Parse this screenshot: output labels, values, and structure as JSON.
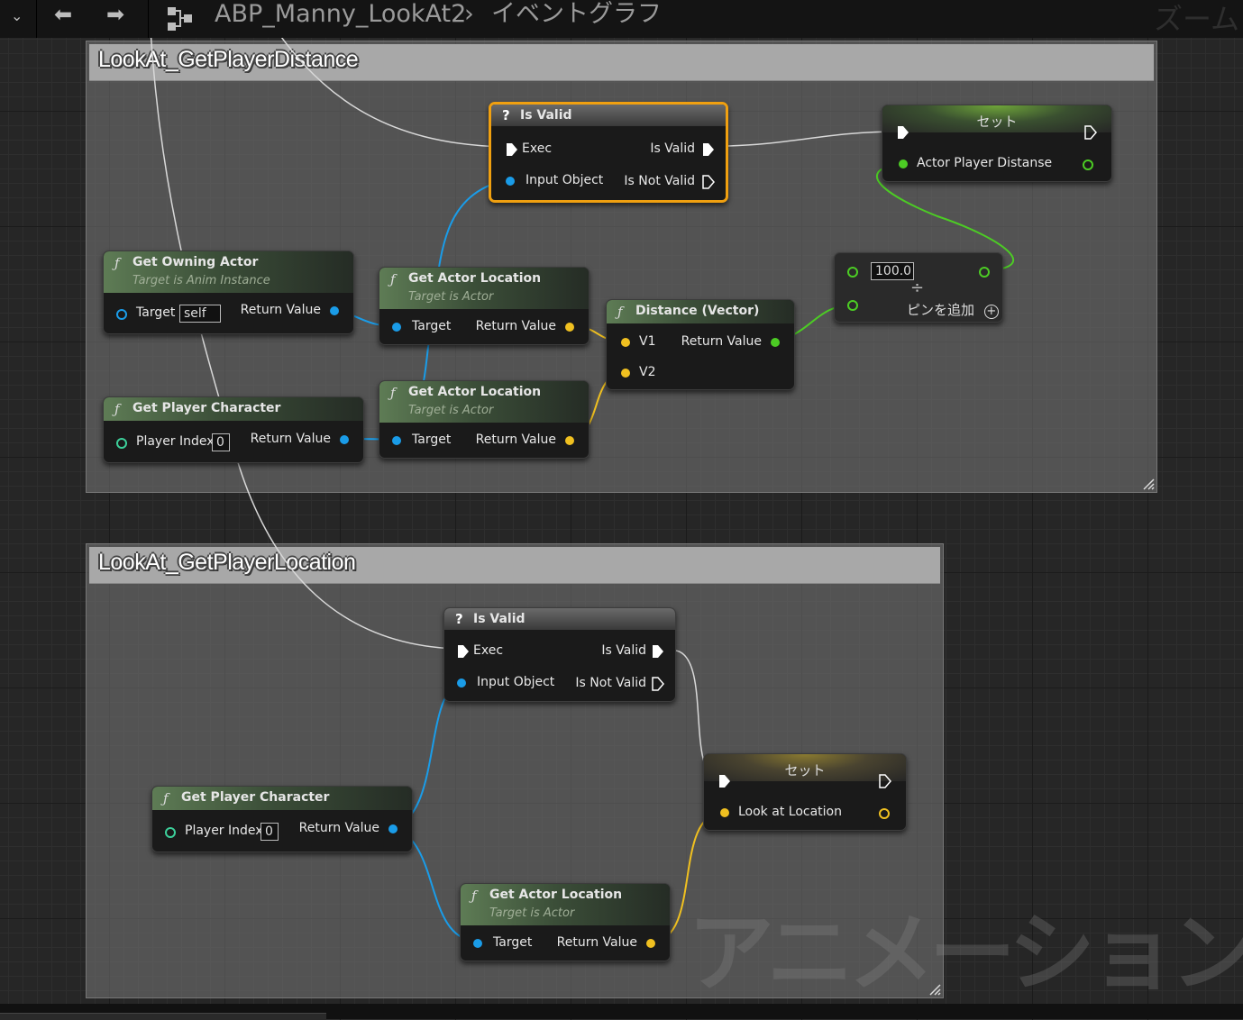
{
  "topbar": {
    "breadcrumb_asset": "ABP_Manny_LookAt2",
    "breadcrumb_separator": "›",
    "breadcrumb_graph": "イベントグラフ",
    "zoom_label": "ズーム"
  },
  "comments": [
    {
      "title": "LookAt_GetPlayerDistance"
    },
    {
      "title": "LookAt_GetPlayerLocation"
    }
  ],
  "nodes": {
    "is_valid_1": {
      "title": "Is Valid",
      "exec_in": "Exec",
      "input_object": "Input Object",
      "is_valid": "Is Valid",
      "is_not_valid": "Is Not Valid"
    },
    "set_1": {
      "title": "セット",
      "var": "Actor Player Distanse"
    },
    "get_owning_actor": {
      "title": "Get Owning Actor",
      "subtitle": "Target is Anim Instance",
      "target": "Target",
      "target_value": "self",
      "return": "Return Value"
    },
    "get_actor_location_1": {
      "title": "Get Actor Location",
      "subtitle": "Target is Actor",
      "target": "Target",
      "return": "Return Value"
    },
    "get_actor_location_2": {
      "title": "Get Actor Location",
      "subtitle": "Target is Actor",
      "target": "Target",
      "return": "Return Value"
    },
    "distance": {
      "title": "Distance (Vector)",
      "v1": "V1",
      "v2": "V2",
      "return": "Return Value"
    },
    "divide": {
      "value": "100.0",
      "add_pin": "ピンを追加"
    },
    "get_player_character_1": {
      "title": "Get Player Character",
      "player_index": "Player Index",
      "index_value": "0",
      "return": "Return Value"
    },
    "is_valid_2": {
      "title": "Is Valid",
      "exec_in": "Exec",
      "input_object": "Input Object",
      "is_valid": "Is Valid",
      "is_not_valid": "Is Not Valid"
    },
    "set_2": {
      "title": "セット",
      "var": "Look at Location"
    },
    "get_player_character_2": {
      "title": "Get Player Character",
      "player_index": "Player Index",
      "index_value": "0",
      "return": "Return Value"
    },
    "get_actor_location_3": {
      "title": "Get Actor Location",
      "subtitle": "Target is Actor",
      "target": "Target",
      "return": "Return Value"
    }
  },
  "watermark": "アニメーション",
  "colors": {
    "exec": "#ffffff",
    "object_pin": "#1a9ce8",
    "vector_pin": "#f0c020",
    "float_pin": "#4ccc24",
    "selected_outline": "#f0a010"
  }
}
